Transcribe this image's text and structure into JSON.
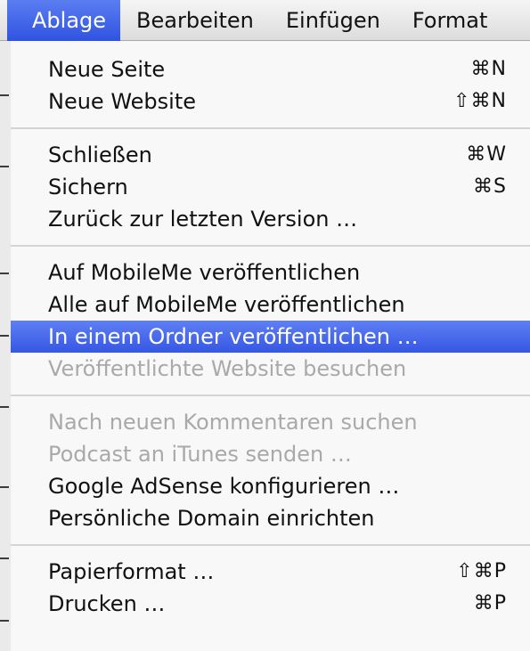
{
  "menubar": {
    "items": [
      {
        "label": "Ablage",
        "active": true
      },
      {
        "label": "Bearbeiten",
        "active": false
      },
      {
        "label": "Einfügen",
        "active": false
      },
      {
        "label": "Format",
        "active": false
      }
    ]
  },
  "menu": {
    "groups": [
      [
        {
          "label": "Neue Seite",
          "shortcut": "⌘N",
          "enabled": true
        },
        {
          "label": "Neue Website",
          "shortcut": "⇧⌘N",
          "enabled": true
        }
      ],
      [
        {
          "label": "Schließen",
          "shortcut": "⌘W",
          "enabled": true
        },
        {
          "label": "Sichern",
          "shortcut": "⌘S",
          "enabled": true
        },
        {
          "label": "Zurück zur letzten Version …",
          "shortcut": "",
          "enabled": true
        }
      ],
      [
        {
          "label": "Auf MobileMe veröffentlichen",
          "shortcut": "",
          "enabled": true
        },
        {
          "label": "Alle auf MobileMe veröffentlichen",
          "shortcut": "",
          "enabled": true
        },
        {
          "label": "In einem Ordner veröffentlichen …",
          "shortcut": "",
          "enabled": true,
          "highlighted": true
        },
        {
          "label": "Veröffentlichte Website besuchen",
          "shortcut": "",
          "enabled": false
        }
      ],
      [
        {
          "label": "Nach neuen Kommentaren suchen",
          "shortcut": "",
          "enabled": false
        },
        {
          "label": "Podcast an iTunes senden …",
          "shortcut": "",
          "enabled": false
        },
        {
          "label": "Google AdSense konfigurieren …",
          "shortcut": "",
          "enabled": true
        },
        {
          "label": "Persönliche Domain einrichten",
          "shortcut": "",
          "enabled": true
        }
      ],
      [
        {
          "label": "Papierformat …",
          "shortcut": "⇧⌘P",
          "enabled": true
        },
        {
          "label": "Drucken …",
          "shortcut": "⌘P",
          "enabled": true
        }
      ]
    ]
  },
  "colors": {
    "highlight": "#3f62e8",
    "disabled_text": "#a9a9a9",
    "text": "#111111"
  }
}
